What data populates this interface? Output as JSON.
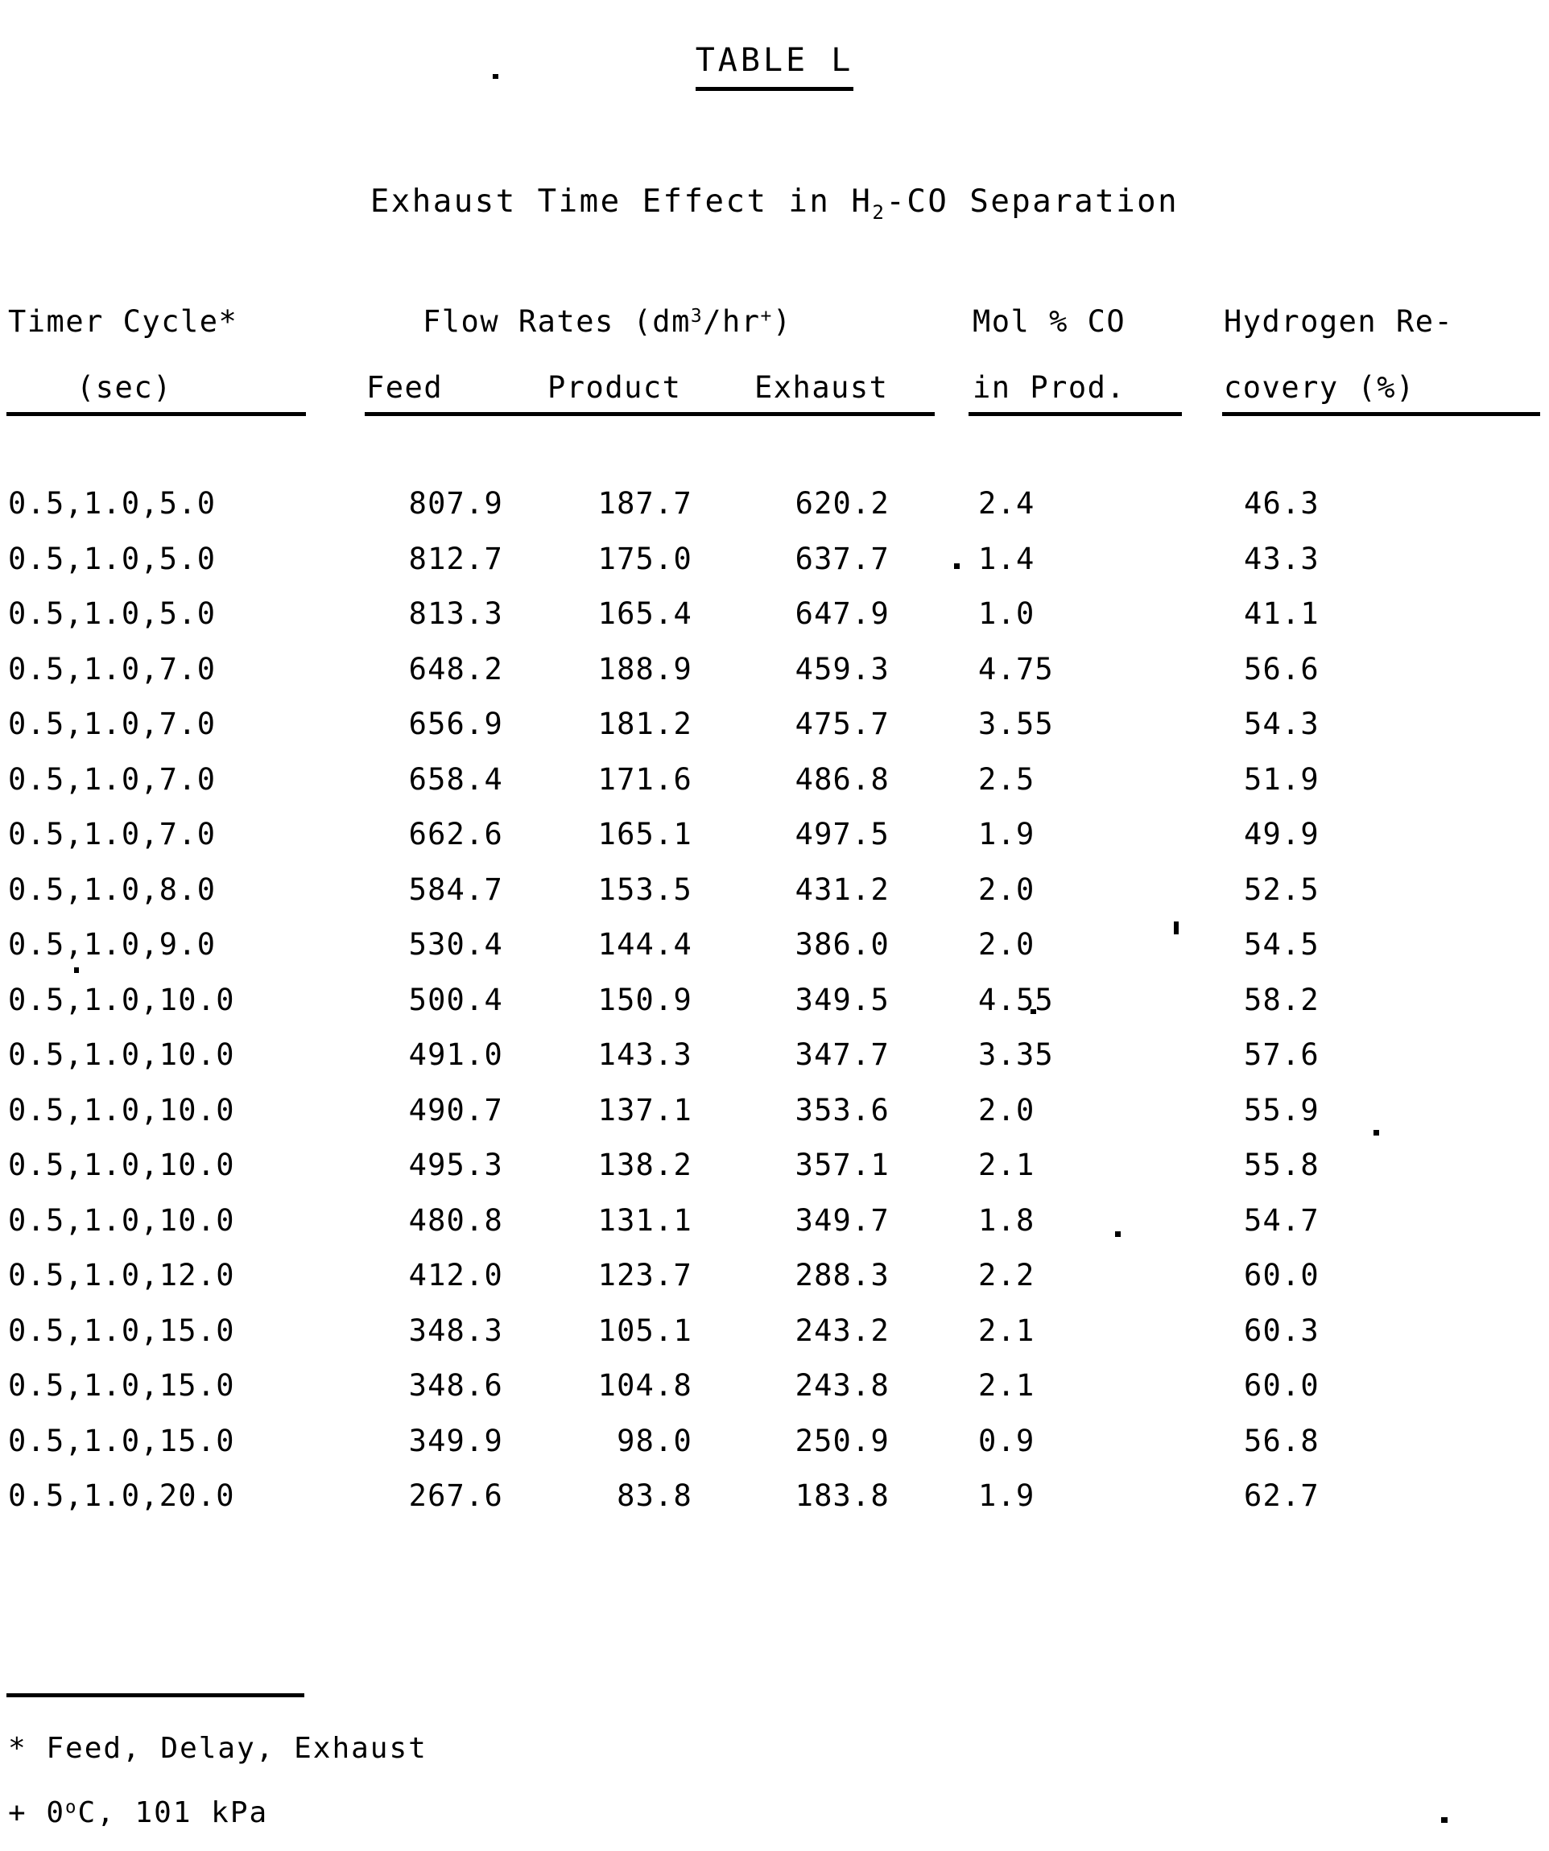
{
  "document": {
    "table_label": "TABLE L",
    "subtitle_prefix": "Exhaust Time Effect in H",
    "subtitle_subscript": "2",
    "subtitle_suffix": "-CO Separation"
  },
  "headers": {
    "top": {
      "timer_cycle": "Timer Cycle*",
      "flow_rates_prefix": "Flow Rates (dm",
      "flow_rates_sup1": "3",
      "flow_rates_mid": "/hr",
      "flow_rates_sup2": "+",
      "flow_rates_suffix": ")",
      "mol_co": "Mol % CO",
      "hydrogen_recovery": "Hydrogen Re-"
    },
    "bottom": {
      "sec": "(sec)",
      "feed": "Feed",
      "product": "Product",
      "exhaust": "Exhaust",
      "in_prod": "in Prod.",
      "covery": "covery (%)"
    }
  },
  "chart_data": {
    "type": "table",
    "title": "TABLE L",
    "subtitle": "Exhaust Time Effect in H2-CO Separation",
    "columns": [
      "Timer Cycle* (sec)",
      "Flow Rates (dm3/hr+) Feed",
      "Flow Rates (dm3/hr+) Product",
      "Flow Rates (dm3/hr+) Exhaust",
      "Mol % CO in Prod.",
      "Hydrogen Recovery (%)"
    ],
    "rows": [
      {
        "cycle": "0.5,1.0,5.0",
        "feed": "807.9",
        "product": "187.7",
        "exhaust": "620.2",
        "mol_co": "2.4",
        "recovery": "46.3"
      },
      {
        "cycle": "0.5,1.0,5.0",
        "feed": "812.7",
        "product": "175.0",
        "exhaust": "637.7",
        "mol_co": "1.4",
        "recovery": "43.3"
      },
      {
        "cycle": "0.5,1.0,5.0",
        "feed": "813.3",
        "product": "165.4",
        "exhaust": "647.9",
        "mol_co": "1.0",
        "recovery": "41.1"
      },
      {
        "cycle": "0.5,1.0,7.0",
        "feed": "648.2",
        "product": "188.9",
        "exhaust": "459.3",
        "mol_co": "4.75",
        "recovery": "56.6"
      },
      {
        "cycle": "0.5,1.0,7.0",
        "feed": "656.9",
        "product": "181.2",
        "exhaust": "475.7",
        "mol_co": "3.55",
        "recovery": "54.3"
      },
      {
        "cycle": "0.5,1.0,7.0",
        "feed": "658.4",
        "product": "171.6",
        "exhaust": "486.8",
        "mol_co": "2.5",
        "recovery": "51.9"
      },
      {
        "cycle": "0.5,1.0,7.0",
        "feed": "662.6",
        "product": "165.1",
        "exhaust": "497.5",
        "mol_co": "1.9",
        "recovery": "49.9"
      },
      {
        "cycle": "0.5,1.0,8.0",
        "feed": "584.7",
        "product": "153.5",
        "exhaust": "431.2",
        "mol_co": "2.0",
        "recovery": "52.5"
      },
      {
        "cycle": "0.5,1.0,9.0",
        "feed": "530.4",
        "product": "144.4",
        "exhaust": "386.0",
        "mol_co": "2.0",
        "recovery": "54.5"
      },
      {
        "cycle": "0.5,1.0,10.0",
        "feed": "500.4",
        "product": "150.9",
        "exhaust": "349.5",
        "mol_co": "4.55",
        "recovery": "58.2"
      },
      {
        "cycle": "0.5,1.0,10.0",
        "feed": "491.0",
        "product": "143.3",
        "exhaust": "347.7",
        "mol_co": "3.35",
        "recovery": "57.6"
      },
      {
        "cycle": "0.5,1.0,10.0",
        "feed": "490.7",
        "product": "137.1",
        "exhaust": "353.6",
        "mol_co": "2.0",
        "recovery": "55.9"
      },
      {
        "cycle": "0.5,1.0,10.0",
        "feed": "495.3",
        "product": "138.2",
        "exhaust": "357.1",
        "mol_co": "2.1",
        "recovery": "55.8"
      },
      {
        "cycle": "0.5,1.0,10.0",
        "feed": "480.8",
        "product": "131.1",
        "exhaust": "349.7",
        "mol_co": "1.8",
        "recovery": "54.7"
      },
      {
        "cycle": "0.5,1.0,12.0",
        "feed": "412.0",
        "product": "123.7",
        "exhaust": "288.3",
        "mol_co": "2.2",
        "recovery": "60.0"
      },
      {
        "cycle": "0.5,1.0,15.0",
        "feed": "348.3",
        "product": "105.1",
        "exhaust": "243.2",
        "mol_co": "2.1",
        "recovery": "60.3"
      },
      {
        "cycle": "0.5,1.0,15.0",
        "feed": "348.6",
        "product": "104.8",
        "exhaust": "243.8",
        "mol_co": "2.1",
        "recovery": "60.0"
      },
      {
        "cycle": "0.5,1.0,15.0",
        "feed": "349.9",
        "product": "98.0",
        "exhaust": "250.9",
        "mol_co": "0.9",
        "recovery": "56.8"
      },
      {
        "cycle": "0.5,1.0,20.0",
        "feed": "267.6",
        "product": "83.8",
        "exhaust": "183.8",
        "mol_co": "1.9",
        "recovery": "62.7"
      }
    ]
  },
  "footnotes": {
    "star": "* Feed, Delay, Exhaust",
    "plus_prefix": "+ 0",
    "plus_sup": "o",
    "plus_suffix": "C, 101 kPa"
  }
}
